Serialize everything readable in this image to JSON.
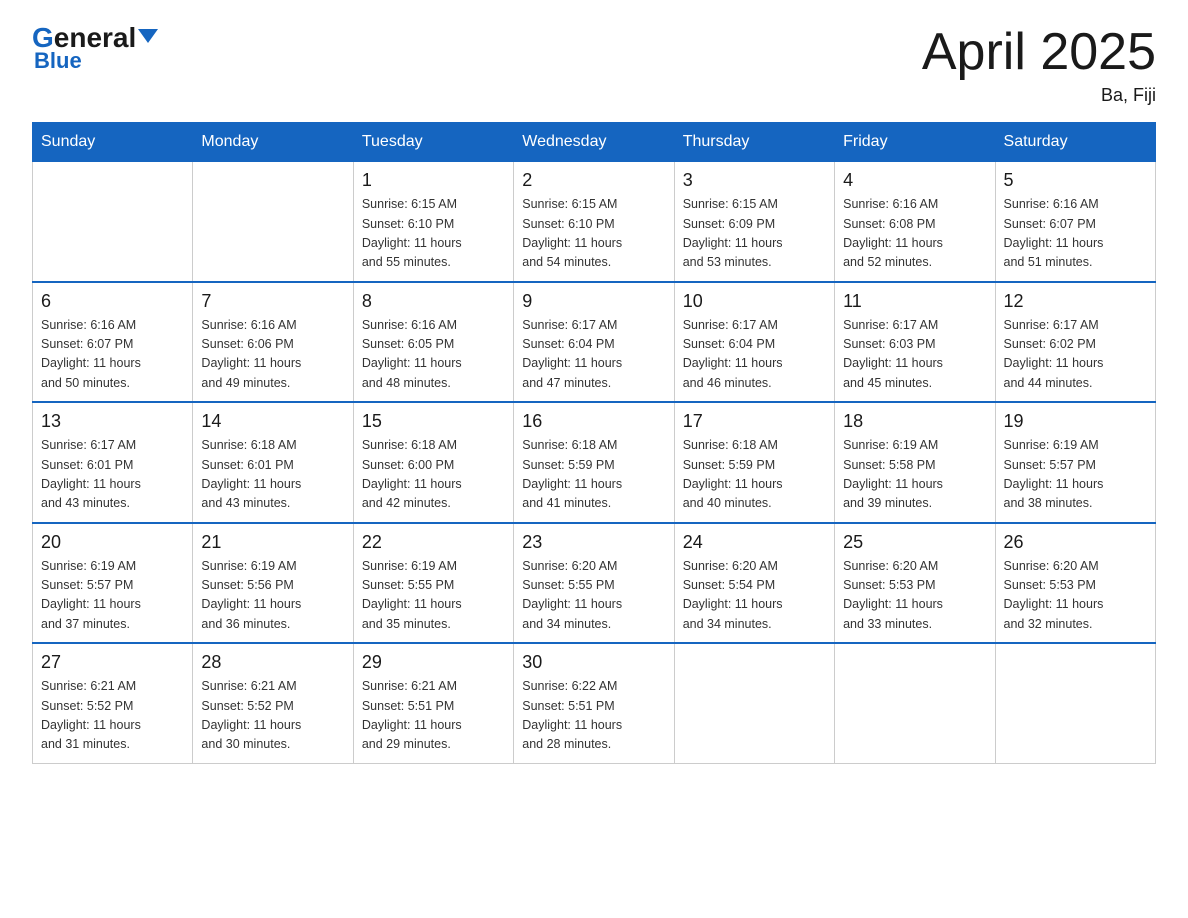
{
  "header": {
    "logo_general": "General",
    "logo_blue": "Blue",
    "title": "April 2025",
    "subtitle": "Ba, Fiji"
  },
  "weekdays": [
    "Sunday",
    "Monday",
    "Tuesday",
    "Wednesday",
    "Thursday",
    "Friday",
    "Saturday"
  ],
  "weeks": [
    [
      {
        "day": "",
        "info": ""
      },
      {
        "day": "",
        "info": ""
      },
      {
        "day": "1",
        "info": "Sunrise: 6:15 AM\nSunset: 6:10 PM\nDaylight: 11 hours\nand 55 minutes."
      },
      {
        "day": "2",
        "info": "Sunrise: 6:15 AM\nSunset: 6:10 PM\nDaylight: 11 hours\nand 54 minutes."
      },
      {
        "day": "3",
        "info": "Sunrise: 6:15 AM\nSunset: 6:09 PM\nDaylight: 11 hours\nand 53 minutes."
      },
      {
        "day": "4",
        "info": "Sunrise: 6:16 AM\nSunset: 6:08 PM\nDaylight: 11 hours\nand 52 minutes."
      },
      {
        "day": "5",
        "info": "Sunrise: 6:16 AM\nSunset: 6:07 PM\nDaylight: 11 hours\nand 51 minutes."
      }
    ],
    [
      {
        "day": "6",
        "info": "Sunrise: 6:16 AM\nSunset: 6:07 PM\nDaylight: 11 hours\nand 50 minutes."
      },
      {
        "day": "7",
        "info": "Sunrise: 6:16 AM\nSunset: 6:06 PM\nDaylight: 11 hours\nand 49 minutes."
      },
      {
        "day": "8",
        "info": "Sunrise: 6:16 AM\nSunset: 6:05 PM\nDaylight: 11 hours\nand 48 minutes."
      },
      {
        "day": "9",
        "info": "Sunrise: 6:17 AM\nSunset: 6:04 PM\nDaylight: 11 hours\nand 47 minutes."
      },
      {
        "day": "10",
        "info": "Sunrise: 6:17 AM\nSunset: 6:04 PM\nDaylight: 11 hours\nand 46 minutes."
      },
      {
        "day": "11",
        "info": "Sunrise: 6:17 AM\nSunset: 6:03 PM\nDaylight: 11 hours\nand 45 minutes."
      },
      {
        "day": "12",
        "info": "Sunrise: 6:17 AM\nSunset: 6:02 PM\nDaylight: 11 hours\nand 44 minutes."
      }
    ],
    [
      {
        "day": "13",
        "info": "Sunrise: 6:17 AM\nSunset: 6:01 PM\nDaylight: 11 hours\nand 43 minutes."
      },
      {
        "day": "14",
        "info": "Sunrise: 6:18 AM\nSunset: 6:01 PM\nDaylight: 11 hours\nand 43 minutes."
      },
      {
        "day": "15",
        "info": "Sunrise: 6:18 AM\nSunset: 6:00 PM\nDaylight: 11 hours\nand 42 minutes."
      },
      {
        "day": "16",
        "info": "Sunrise: 6:18 AM\nSunset: 5:59 PM\nDaylight: 11 hours\nand 41 minutes."
      },
      {
        "day": "17",
        "info": "Sunrise: 6:18 AM\nSunset: 5:59 PM\nDaylight: 11 hours\nand 40 minutes."
      },
      {
        "day": "18",
        "info": "Sunrise: 6:19 AM\nSunset: 5:58 PM\nDaylight: 11 hours\nand 39 minutes."
      },
      {
        "day": "19",
        "info": "Sunrise: 6:19 AM\nSunset: 5:57 PM\nDaylight: 11 hours\nand 38 minutes."
      }
    ],
    [
      {
        "day": "20",
        "info": "Sunrise: 6:19 AM\nSunset: 5:57 PM\nDaylight: 11 hours\nand 37 minutes."
      },
      {
        "day": "21",
        "info": "Sunrise: 6:19 AM\nSunset: 5:56 PM\nDaylight: 11 hours\nand 36 minutes."
      },
      {
        "day": "22",
        "info": "Sunrise: 6:19 AM\nSunset: 5:55 PM\nDaylight: 11 hours\nand 35 minutes."
      },
      {
        "day": "23",
        "info": "Sunrise: 6:20 AM\nSunset: 5:55 PM\nDaylight: 11 hours\nand 34 minutes."
      },
      {
        "day": "24",
        "info": "Sunrise: 6:20 AM\nSunset: 5:54 PM\nDaylight: 11 hours\nand 34 minutes."
      },
      {
        "day": "25",
        "info": "Sunrise: 6:20 AM\nSunset: 5:53 PM\nDaylight: 11 hours\nand 33 minutes."
      },
      {
        "day": "26",
        "info": "Sunrise: 6:20 AM\nSunset: 5:53 PM\nDaylight: 11 hours\nand 32 minutes."
      }
    ],
    [
      {
        "day": "27",
        "info": "Sunrise: 6:21 AM\nSunset: 5:52 PM\nDaylight: 11 hours\nand 31 minutes."
      },
      {
        "day": "28",
        "info": "Sunrise: 6:21 AM\nSunset: 5:52 PM\nDaylight: 11 hours\nand 30 minutes."
      },
      {
        "day": "29",
        "info": "Sunrise: 6:21 AM\nSunset: 5:51 PM\nDaylight: 11 hours\nand 29 minutes."
      },
      {
        "day": "30",
        "info": "Sunrise: 6:22 AM\nSunset: 5:51 PM\nDaylight: 11 hours\nand 28 minutes."
      },
      {
        "day": "",
        "info": ""
      },
      {
        "day": "",
        "info": ""
      },
      {
        "day": "",
        "info": ""
      }
    ]
  ]
}
